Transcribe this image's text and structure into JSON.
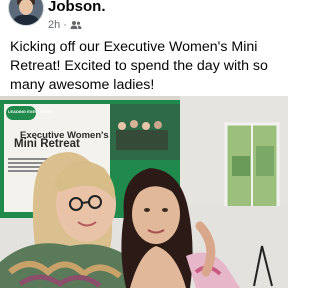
{
  "post": {
    "author": "Jobson.",
    "timestamp": "2h",
    "audience_icon": "friends-icon",
    "text": "Kicking off our Executive Women's Mini Retreat! Excited to spend the day with so many awesome ladies!"
  },
  "photo": {
    "banner_logo": "LEADING EXECUTIVES",
    "banner_title": "Executive Women's",
    "banner_subtitle": "Mini Retreat"
  },
  "colors": {
    "banner_green": "#1f8a4c",
    "text_primary": "#050505",
    "text_secondary": "#65676b"
  }
}
